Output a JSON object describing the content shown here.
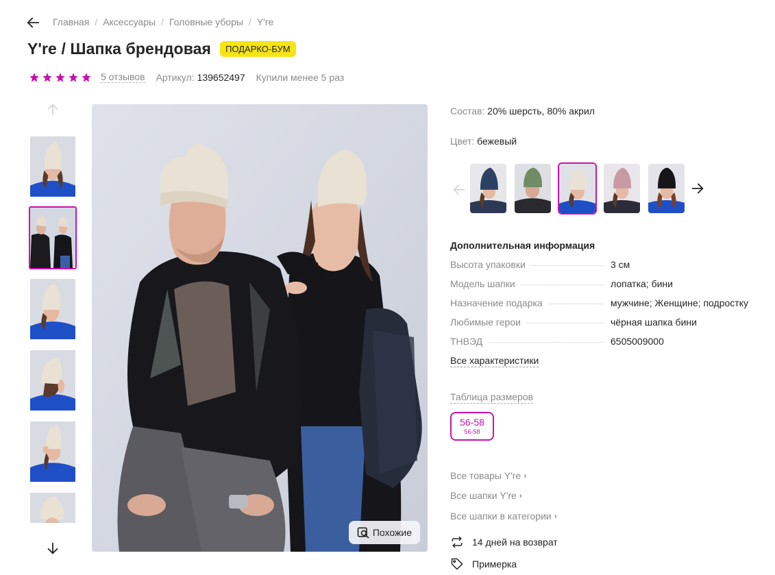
{
  "breadcrumb": {
    "items": [
      "Главная",
      "Аксессуары",
      "Головные уборы",
      "Y're"
    ],
    "separator": "/"
  },
  "product": {
    "title": "Y're / Шапка брендовая",
    "promo_badge": "ПОДАРКО-БУМ",
    "rating_stars": 5,
    "reviews_label": "5 отзывов",
    "article_label": "Артикул:",
    "article_value": "139652497",
    "purchases": "Купили менее 5 раз"
  },
  "gallery": {
    "thumbnails_count": 6,
    "active_thumbnail": 1,
    "similar_button": "Похожие"
  },
  "details": {
    "composition_label": "Состав:",
    "composition_value": "20% шерсть, 80% акрил",
    "color_label": "Цвет:",
    "color_value": "бежевый",
    "color_variants": [
      "navy",
      "olive",
      "beige",
      "pink",
      "black"
    ],
    "active_variant": 2
  },
  "additional_info": {
    "title": "Дополнительная информация",
    "specs": [
      {
        "key": "Высота упаковки",
        "value": "3 см"
      },
      {
        "key": "Модель шапки",
        "value": "лопатка; бини"
      },
      {
        "key": "Назначение подарка",
        "value": "мужчине; Женщине; подростку"
      },
      {
        "key": "Любимые герои",
        "value": "чёрная шапка бини"
      },
      {
        "key": "ТНВЭД",
        "value": "6505009000"
      }
    ],
    "all_specs_link": "Все характеристики"
  },
  "sizes": {
    "table_link": "Таблица размеров",
    "selected_size": "56-58",
    "selected_size_sub": "56-58"
  },
  "related_links": [
    "Все товары Y're",
    "Все шапки Y're",
    "Все шапки в категории"
  ],
  "features": {
    "return": "14 дней на возврат",
    "fitting": "Примерка"
  },
  "colors": {
    "accent": "#cb11ab",
    "badge": "#f5e514",
    "muted_text": "#8a8a8a",
    "text": "#242424"
  }
}
